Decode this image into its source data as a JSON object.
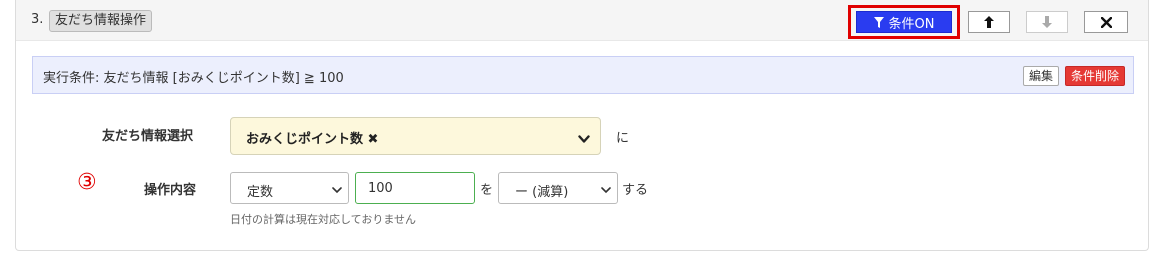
{
  "header": {
    "step_number": "3.",
    "step_label": "友だち情報操作",
    "condition_button_label": "条件ON",
    "condition_icon": "filter-icon",
    "up_icon": "arrow-up-icon",
    "down_icon": "arrow-down-icon",
    "close_icon": "close-icon"
  },
  "condition_bar": {
    "text": "実行条件: 友だち情報 [おみくじポイント数] ≧ 100",
    "edit_label": "編集",
    "delete_label": "条件削除"
  },
  "form": {
    "friend_select_label": "友だち情報選択",
    "friend_select_value": "おみくじポイント数 ✖",
    "friend_select_suffix": "に",
    "annotation_number": "③",
    "operation_label": "操作内容",
    "type_select_value": "定数",
    "value_input": "100",
    "value_suffix": "を",
    "operator_select_value": "ー (減算)",
    "operator_suffix": "する",
    "note": "日付の計算は現在対応しておりません"
  },
  "colors": {
    "condition_button": "#2a3cf0",
    "highlight_border": "#e00000",
    "delete_button": "#e53935",
    "condition_bar_bg": "#eceffd",
    "friend_select_bg": "#fdf8dc",
    "input_border": "#4caf50"
  }
}
